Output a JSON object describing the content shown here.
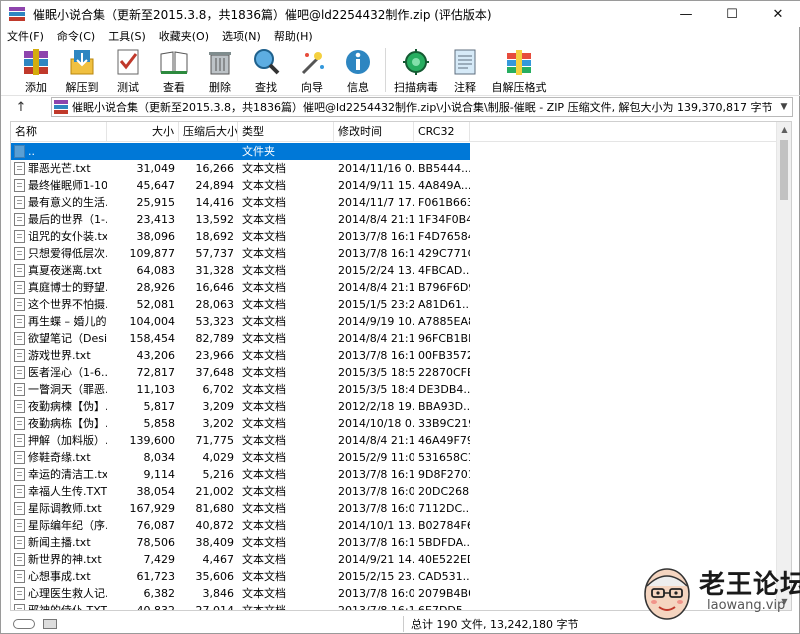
{
  "window": {
    "title": "催眠小说合集（更新至2015.3.8，共1836篇）催吧@ld2254432制作.zip (评估版本)",
    "controls": [
      "—",
      "☐",
      "✕"
    ]
  },
  "menu": [
    "文件(F)",
    "命令(C)",
    "工具(S)",
    "收藏夹(O)",
    "选项(N)",
    "帮助(H)"
  ],
  "toolbar": [
    {
      "label": "添加",
      "icon": "add-archive-icon"
    },
    {
      "label": "解压到",
      "icon": "extract-to-icon"
    },
    {
      "label": "测试",
      "icon": "test-icon"
    },
    {
      "label": "查看",
      "icon": "view-icon"
    },
    {
      "label": "删除",
      "icon": "delete-icon"
    },
    {
      "label": "查找",
      "icon": "find-icon"
    },
    {
      "label": "向导",
      "icon": "wizard-icon"
    },
    {
      "label": "信息",
      "icon": "info-icon"
    },
    {
      "label": "扫描病毒",
      "icon": "virus-scan-icon"
    },
    {
      "label": "注释",
      "icon": "comment-icon"
    },
    {
      "label": "自解压格式",
      "icon": "sfx-icon"
    }
  ],
  "address": {
    "up": "↑",
    "path": "催眠小说合集（更新至2015.3.8，共1836篇）催吧@ld2254432制作.zip\\小说合集\\制服-催眠 - ZIP 压缩文件, 解包大小为 139,370,817 字节",
    "dropdown": "▼"
  },
  "columns": [
    "名称",
    "大小",
    "压缩后大小",
    "类型",
    "修改时间",
    "CRC32"
  ],
  "parent_row": {
    "name": "..",
    "type": "文件夹"
  },
  "rows": [
    {
      "name": "罪恶光芒.txt",
      "size": "31,049",
      "packed": "16,266",
      "type": "文本文档",
      "modified": "2014/11/16 0...",
      "crc": "BB5444..."
    },
    {
      "name": "最终催眠师1-10...",
      "size": "45,647",
      "packed": "24,894",
      "type": "文本文档",
      "modified": "2014/9/11 15...",
      "crc": "4A849A..."
    },
    {
      "name": "最有意义的生活...",
      "size": "25,915",
      "packed": "14,416",
      "type": "文本文档",
      "modified": "2014/11/7 17...",
      "crc": "F061B663"
    },
    {
      "name": "最后的世界（1-...",
      "size": "23,413",
      "packed": "13,592",
      "type": "文本文档",
      "modified": "2014/8/4 21:12",
      "crc": "1F34F0B4"
    },
    {
      "name": "诅咒的女仆装.txt",
      "size": "38,096",
      "packed": "18,692",
      "type": "文本文档",
      "modified": "2013/7/8 16:13",
      "crc": "F4D76584"
    },
    {
      "name": "只想爱得低层次...",
      "size": "109,877",
      "packed": "57,737",
      "type": "文本文档",
      "modified": "2013/7/8 16:11",
      "crc": "429C771C"
    },
    {
      "name": "真夏夜迷离.txt",
      "size": "64,083",
      "packed": "31,328",
      "type": "文本文档",
      "modified": "2015/2/24 13...",
      "crc": "4FBCAD..."
    },
    {
      "name": "真庭博士的野望...",
      "size": "28,926",
      "packed": "16,646",
      "type": "文本文档",
      "modified": "2014/8/4 21:12",
      "crc": "B796F6D9"
    },
    {
      "name": "这个世界不怕摄...",
      "size": "52,081",
      "packed": "28,063",
      "type": "文本文档",
      "modified": "2015/1/5 23:21",
      "crc": "A81D61..."
    },
    {
      "name": "再生蝶 – 婚儿的...",
      "size": "104,004",
      "packed": "53,323",
      "type": "文本文档",
      "modified": "2014/9/19 10...",
      "crc": "A7885EA8"
    },
    {
      "name": "欲望笔记（Desi...",
      "size": "158,454",
      "packed": "82,789",
      "type": "文本文档",
      "modified": "2014/8/4 21:12",
      "crc": "96FCB1BF"
    },
    {
      "name": "游戏世界.txt",
      "size": "43,206",
      "packed": "23,966",
      "type": "文本文档",
      "modified": "2013/7/8 16:12",
      "crc": "00FB3572"
    },
    {
      "name": "医者淫心（1-6...",
      "size": "72,817",
      "packed": "37,648",
      "type": "文本文档",
      "modified": "2015/3/5 18:53",
      "crc": "22870CFE"
    },
    {
      "name": "一瞥洞天（罪恶...",
      "size": "11,103",
      "packed": "6,702",
      "type": "文本文档",
      "modified": "2015/3/5 18:44",
      "crc": "DE3DB4..."
    },
    {
      "name": "夜勤病楝【伪】...",
      "size": "5,817",
      "packed": "3,209",
      "type": "文本文档",
      "modified": "2012/2/18 19...",
      "crc": "BBA93D..."
    },
    {
      "name": "夜勤病栋【伪】...",
      "size": "5,858",
      "packed": "3,202",
      "type": "文本文档",
      "modified": "2014/10/18 0...",
      "crc": "33B9C219"
    },
    {
      "name": "押解（加料版）...",
      "size": "139,600",
      "packed": "71,775",
      "type": "文本文档",
      "modified": "2014/8/4 21:11",
      "crc": "46A49F79"
    },
    {
      "name": "修鞋奇缘.txt",
      "size": "8,034",
      "packed": "4,029",
      "type": "文本文档",
      "modified": "2015/2/9 11:04",
      "crc": "531658C1"
    },
    {
      "name": "幸运的清洁工.txt",
      "size": "9,114",
      "packed": "5,216",
      "type": "文本文档",
      "modified": "2013/7/8 16:11",
      "crc": "9D8F2701"
    },
    {
      "name": "幸福人生传.TXT",
      "size": "38,054",
      "packed": "21,002",
      "type": "文本文档",
      "modified": "2013/7/8 16:05",
      "crc": "20DC268F"
    },
    {
      "name": "星际调教师.txt",
      "size": "167,929",
      "packed": "81,680",
      "type": "文本文档",
      "modified": "2013/7/8 16:06",
      "crc": "7112DC..."
    },
    {
      "name": "星际编年纪（序...",
      "size": "76,087",
      "packed": "40,872",
      "type": "文本文档",
      "modified": "2014/10/1 13...",
      "crc": "B02784F6"
    },
    {
      "name": "新闻主播.txt",
      "size": "78,506",
      "packed": "38,409",
      "type": "文本文档",
      "modified": "2013/7/8 16:12",
      "crc": "5BDFDA..."
    },
    {
      "name": "新世界的神.txt",
      "size": "7,429",
      "packed": "4,467",
      "type": "文本文档",
      "modified": "2014/9/21 14...",
      "crc": "40E522ED"
    },
    {
      "name": "心想事成.txt",
      "size": "61,723",
      "packed": "35,606",
      "type": "文本文档",
      "modified": "2015/2/15 23...",
      "crc": "CAD531..."
    },
    {
      "name": "心理医生救人记...",
      "size": "6,382",
      "packed": "3,846",
      "type": "文本文档",
      "modified": "2013/7/8 16:05",
      "crc": "2079B4B0"
    },
    {
      "name": "邪神的侍仆.TXT",
      "size": "40,832",
      "packed": "27,014",
      "type": "文本文档",
      "modified": "2013/7/8 16:12",
      "crc": "6E7DD5..."
    }
  ],
  "status": {
    "summary": "总计 190 文件, 13,242,180 字节"
  },
  "watermark": {
    "title": "老王论坛",
    "url": "laowang.vip"
  },
  "colors": {
    "selection": "#0078d7",
    "accent_red": "#c0392b"
  }
}
